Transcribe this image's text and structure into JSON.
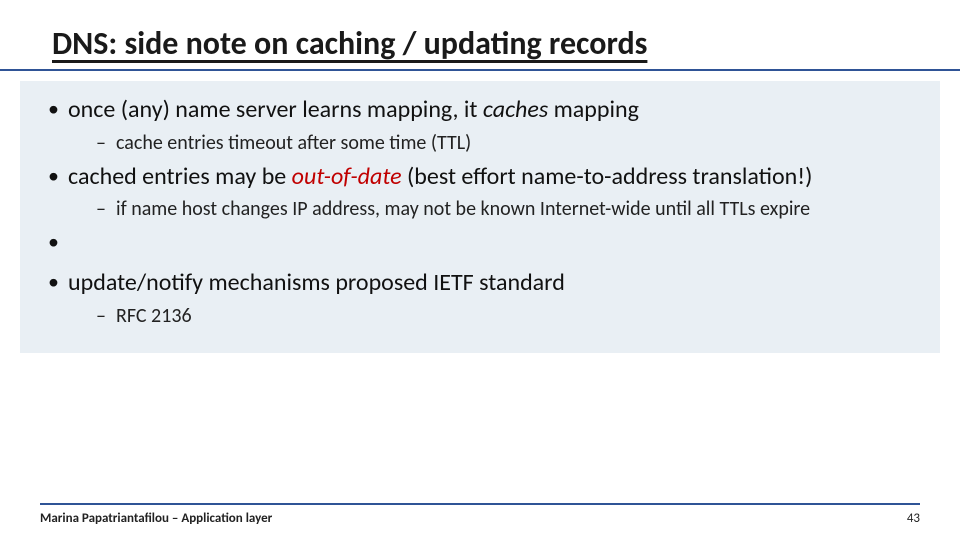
{
  "title": "DNS: side note on caching / updating records",
  "bullets": {
    "b1_pre": "once (any) name server learns mapping, it ",
    "b1_em": "caches",
    "b1_post": " mapping",
    "b1_sub1": "cache entries timeout after some time (TTL)",
    "b2_pre": "cached entries may be ",
    "b2_em": "out-of-date",
    "b2_post": " (best effort name-to-address translation!)",
    "b2_sub1": "if name host changes IP address, may not be known Internet-wide until all TTLs expire",
    "b3": "update/notify mechanisms proposed IETF standard",
    "b3_sub1": "RFC 2136"
  },
  "footer": {
    "author": "Marina Papatriantafilou – Application layer",
    "page": "43"
  }
}
